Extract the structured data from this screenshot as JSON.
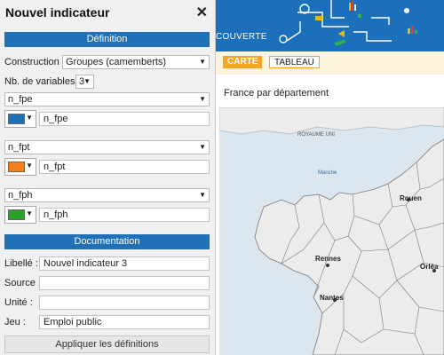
{
  "panel": {
    "title": "Nouvel indicateur",
    "definition_header": "Définition",
    "construction_label": "Construction",
    "construction_value": "Groupes (camemberts)",
    "nb_variables_label": "Nb. de variables",
    "nb_variables_value": "3",
    "variables": [
      {
        "select": "n_fpe",
        "color": "#1f6fb3",
        "name": "n_fpe"
      },
      {
        "select": "n_fpt",
        "color": "#f57f1d",
        "name": "n_fpt"
      },
      {
        "select": "n_fph",
        "color": "#2ca02c",
        "name": "n_fph"
      }
    ],
    "documentation_header": "Documentation",
    "libelle_label": "Libellé :",
    "libelle_value": "Nouvel indicateur 3",
    "source_label": "Source :",
    "source_value": "",
    "unite_label": "Unité :",
    "unite_value": "",
    "jeu_label": "Jeu :",
    "jeu_value": "Emploi public",
    "apply_label": "Appliquer les définitions"
  },
  "banner": {
    "text": "COUVERTE"
  },
  "tabs": [
    {
      "label": "CARTE",
      "active": true
    },
    {
      "label": "TABLEAU",
      "active": false
    }
  ],
  "map": {
    "title": "France par département",
    "labels": {
      "uk": "ROYAUME UNI",
      "manche": "Manche",
      "rouen": "Rouen",
      "rennes": "Rennes",
      "nantes": "Nantes",
      "orleans": "Orléa"
    }
  }
}
